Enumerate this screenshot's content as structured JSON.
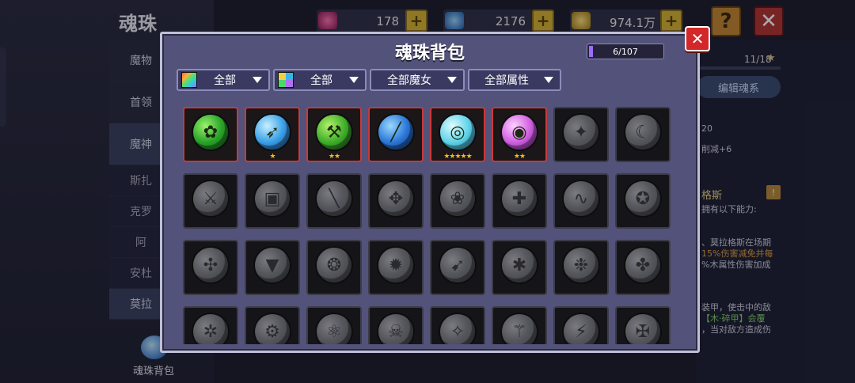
{
  "background": {
    "page_title": "魂珠",
    "resources": [
      {
        "icon": "pink-gem-icon",
        "value": "178",
        "color": "#d0307a"
      },
      {
        "icon": "blue-gem-icon",
        "value": "2176",
        "color": "#3a8fe0"
      },
      {
        "icon": "gold-coin-icon",
        "value": "974.1万",
        "color": "#d8b030"
      }
    ],
    "help_label": "?",
    "close_label": "✕",
    "sidebar": [
      "魔物",
      "首领",
      "魔神",
      "斯扎",
      "克罗",
      "阿",
      "安杜",
      "莫拉"
    ],
    "bag_label": "魂珠背包",
    "right_panel": {
      "count": "11/18",
      "edit_button": "编辑魂系",
      "lines": [
        "20",
        "削减+6",
        "格斯",
        "拥有以下能力:",
        "、莫拉格斯在场期",
        "15%伤害减免并每",
        "%木属性伤害加成",
        "装甲，使击中的敌",
        "【木·碎甲】会覆",
        "，当对敌方造成伤"
      ]
    }
  },
  "modal": {
    "title": "魂珠背包",
    "capacity": "6/107",
    "capacity_fraction": 0.056,
    "close_label": "✕",
    "filters": [
      {
        "icon": "rainbow",
        "label": "全部"
      },
      {
        "icon": "grid",
        "label": "全部"
      },
      {
        "icon": "",
        "label": "全部魔女"
      },
      {
        "icon": "",
        "label": "全部属性"
      }
    ],
    "orbs": [
      {
        "name": "green-clover-orb",
        "owned": true,
        "colors": [
          "#9af26a",
          "#2aa32a",
          "#0d5a12"
        ],
        "symbol": "✿",
        "stars": 0
      },
      {
        "name": "blue-bow-orb",
        "owned": true,
        "colors": [
          "#c8f0ff",
          "#3aa0e8",
          "#123a7a"
        ],
        "symbol": "➶",
        "stars": 1
      },
      {
        "name": "green-hammer-orb",
        "owned": true,
        "colors": [
          "#b6f06a",
          "#3fae2a",
          "#16501a"
        ],
        "symbol": "⚒",
        "stars": 2
      },
      {
        "name": "blue-staff-orb",
        "owned": true,
        "colors": [
          "#9ad8ff",
          "#2b78d8",
          "#0e2a6a"
        ],
        "symbol": "╱",
        "stars": 0
      },
      {
        "name": "golden-ring-orb",
        "owned": true,
        "colors": [
          "#e0fbff",
          "#5fd3e8",
          "#1a6a8a"
        ],
        "symbol": "◎",
        "stars": 5
      },
      {
        "name": "pink-crystal-orb",
        "owned": true,
        "colors": [
          "#ffd0ff",
          "#d060e0",
          "#5a1a7a"
        ],
        "symbol": "◉",
        "stars": 2
      },
      {
        "name": "locked-orb",
        "owned": false,
        "symbol": "✦",
        "stars": 0
      },
      {
        "name": "locked-orb",
        "owned": false,
        "symbol": "☾",
        "stars": 0
      },
      {
        "name": "locked-orb",
        "owned": false,
        "symbol": "⚔",
        "stars": 0
      },
      {
        "name": "locked-orb",
        "owned": false,
        "symbol": "▣",
        "stars": 0
      },
      {
        "name": "locked-orb",
        "owned": false,
        "symbol": "╲",
        "stars": 0
      },
      {
        "name": "locked-orb",
        "owned": false,
        "symbol": "✥",
        "stars": 0
      },
      {
        "name": "locked-orb",
        "owned": false,
        "symbol": "❀",
        "stars": 0
      },
      {
        "name": "locked-orb",
        "owned": false,
        "symbol": "✚",
        "stars": 0
      },
      {
        "name": "locked-orb",
        "owned": false,
        "symbol": "∿",
        "stars": 0
      },
      {
        "name": "locked-orb",
        "owned": false,
        "symbol": "✪",
        "stars": 0
      },
      {
        "name": "locked-orb",
        "owned": false,
        "symbol": "✣",
        "stars": 0
      },
      {
        "name": "locked-orb",
        "owned": false,
        "symbol": "▼",
        "stars": 0
      },
      {
        "name": "locked-orb",
        "owned": false,
        "symbol": "❂",
        "stars": 0
      },
      {
        "name": "locked-orb",
        "owned": false,
        "symbol": "✹",
        "stars": 0
      },
      {
        "name": "locked-orb",
        "owned": false,
        "symbol": "➹",
        "stars": 0
      },
      {
        "name": "locked-orb",
        "owned": false,
        "symbol": "✱",
        "stars": 0
      },
      {
        "name": "locked-orb",
        "owned": false,
        "symbol": "❉",
        "stars": 0
      },
      {
        "name": "locked-orb",
        "owned": false,
        "symbol": "✤",
        "stars": 0
      },
      {
        "name": "locked-orb",
        "owned": false,
        "symbol": "✲",
        "stars": 0
      },
      {
        "name": "locked-orb",
        "owned": false,
        "symbol": "⚙",
        "stars": 0
      },
      {
        "name": "locked-orb",
        "owned": false,
        "symbol": "⚛",
        "stars": 0
      },
      {
        "name": "locked-orb",
        "owned": false,
        "symbol": "☠",
        "stars": 0
      },
      {
        "name": "locked-orb",
        "owned": false,
        "symbol": "✧",
        "stars": 0
      },
      {
        "name": "locked-orb",
        "owned": false,
        "symbol": "⚚",
        "stars": 0
      },
      {
        "name": "locked-orb",
        "owned": false,
        "symbol": "⚡",
        "stars": 0
      },
      {
        "name": "locked-orb",
        "owned": false,
        "symbol": "✠",
        "stars": 0
      }
    ]
  }
}
